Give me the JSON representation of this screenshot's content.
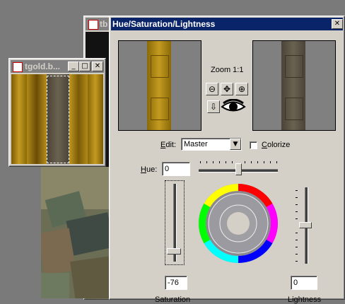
{
  "dialog": {
    "title": "Hue/Saturation/Lightness",
    "close_glyph": "✕",
    "zoom_label": "Zoom 1:1",
    "zoom_out_glyph": "⊖",
    "zoom_fit_glyph": "✥",
    "zoom_in_glyph": "⊕",
    "pan_glyph": "⇩",
    "eye_icon": "eye-icon",
    "edit_label_underlined": "E",
    "edit_label_rest": "dit:",
    "edit_value": "Master",
    "colorize_label_underlined": "C",
    "colorize_label_rest": "olorize",
    "colorize_checked": false,
    "hue_label_underlined": "H",
    "hue_label_rest": "ue:",
    "hue_value": "0",
    "saturation_value": "-76",
    "lightness_value": "0",
    "saturation_label": "Saturation",
    "lightness_label": "Lightness"
  },
  "image_window": {
    "title": "tgold.b...",
    "min_glyph": "_",
    "max_glyph": "□",
    "close_glyph": "✕"
  },
  "back_window": {
    "title_fragment": "tb"
  },
  "colors": {
    "title_active": "#0a246a",
    "title_inactive": "#808080",
    "face": "#d4d0c8",
    "gold": "#b08a10",
    "desaturated": "#5a5446"
  }
}
